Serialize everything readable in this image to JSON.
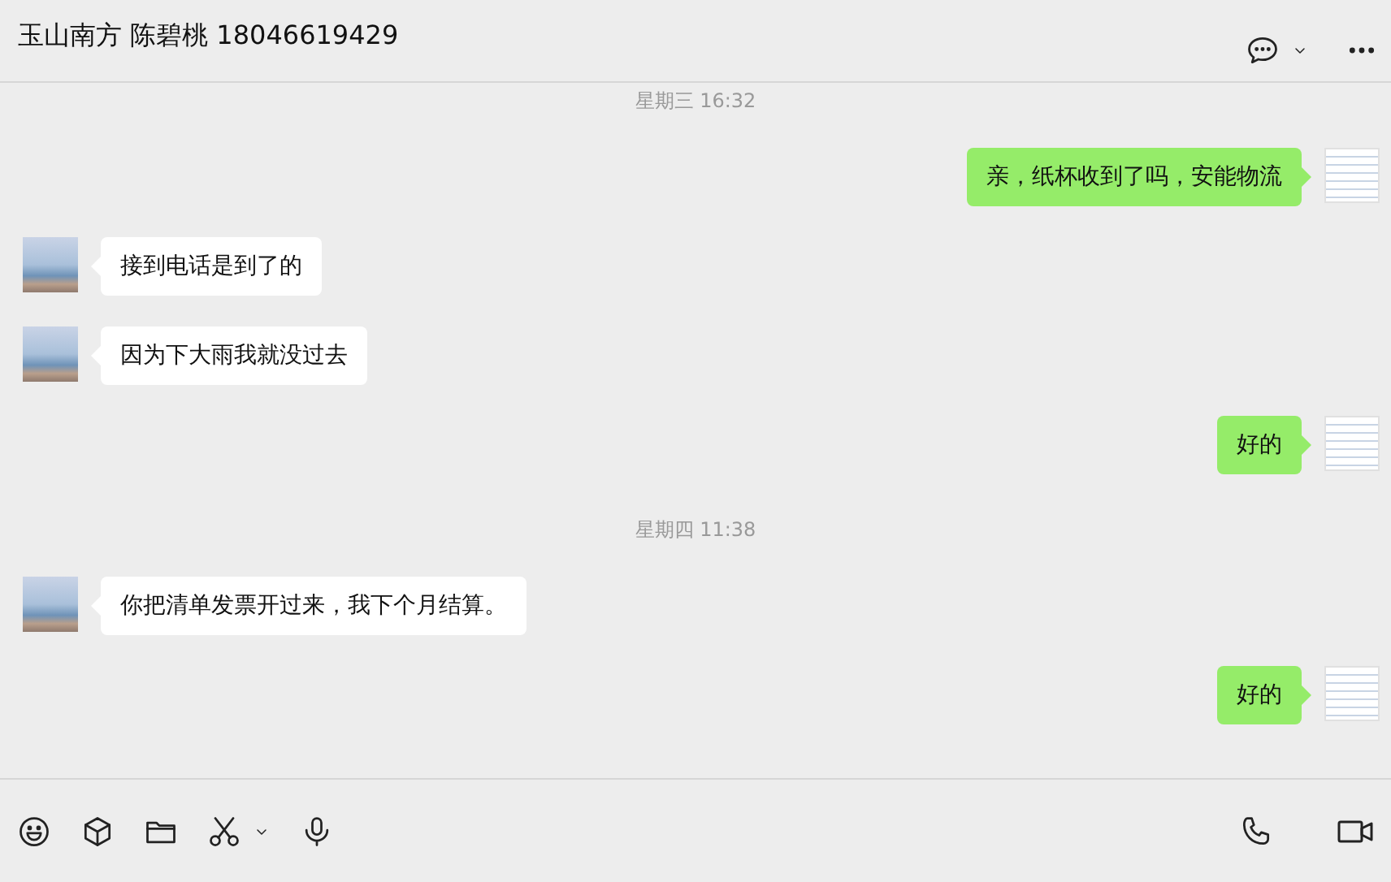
{
  "header": {
    "title": "玉山南方 陈碧桃 18046619429"
  },
  "messages": [
    {
      "kind": "time",
      "text": "星期三 16:32"
    },
    {
      "kind": "sent",
      "text": "亲，纸杯收到了吗，安能物流"
    },
    {
      "kind": "received",
      "text": "接到电话是到了的"
    },
    {
      "kind": "received",
      "text": "因为下大雨我就没过去"
    },
    {
      "kind": "sent",
      "text": "好的"
    },
    {
      "kind": "time",
      "text": "星期四 11:38"
    },
    {
      "kind": "received",
      "text": "你把清单发票开过来，我下个月结算。"
    },
    {
      "kind": "sent",
      "text": "好的"
    }
  ]
}
